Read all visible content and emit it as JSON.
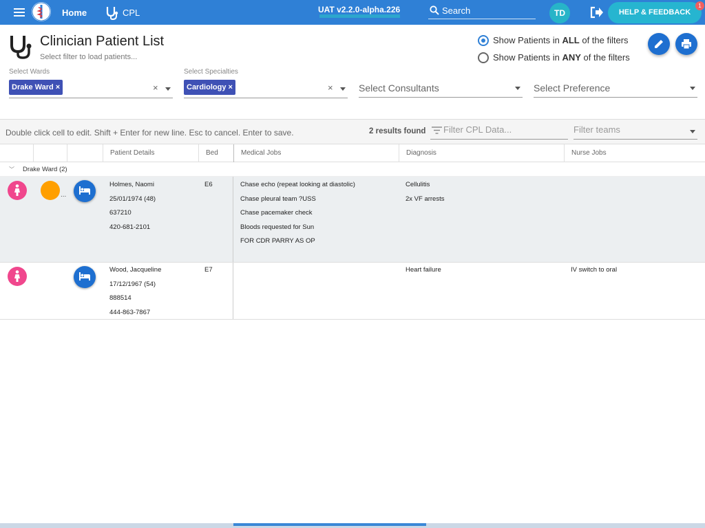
{
  "topbar": {
    "home_label": "Home",
    "app_label": "CPL",
    "version": "UAT v2.2.0-alpha.226",
    "search_label": "Search",
    "user_initials": "TD",
    "help_label": "HELP & FEEDBACK",
    "help_badge": "1"
  },
  "header": {
    "title": "Clinician Patient List",
    "subtitle": "Select filter to load patients...",
    "radio_all_pre": "Show Patients in ",
    "radio_all_bold": "ALL",
    "radio_all_post": " of the filters",
    "radio_any_pre": "Show Patients in ",
    "radio_any_bold": "ANY",
    "radio_any_post": " of the filters",
    "selected_radio": "ALL"
  },
  "filters": {
    "wards_label": "Select Wards",
    "ward_chip": "Drake Ward",
    "specialties_label": "Select Specialties",
    "specialty_chip": "Cardiology",
    "consultants_placeholder": "Select Consultants",
    "preference_placeholder": "Select Preference"
  },
  "toolbar": {
    "hint": "Double click cell to edit. Shift + Enter for new line. Esc to cancel. Enter to save.",
    "results": "2 results found",
    "filter_data_placeholder": "Filter CPL Data...",
    "filter_teams_placeholder": "Filter teams"
  },
  "table": {
    "columns": [
      "Patient Details",
      "Bed",
      "Medical Jobs",
      "Diagnosis",
      "Nurse Jobs"
    ],
    "group_label": "Drake Ward (2)",
    "rows": [
      {
        "name": "Holmes, Naomi",
        "dob": "25/01/1974 (48)",
        "id": "637210",
        "phone": "420-681-2101",
        "bed": "E6",
        "medical_jobs": [
          "Chase echo (repeat looking at diastolic)",
          "Chase pleural team ?USS",
          "Chase pacemaker check",
          "Bloods requested for Sun",
          "FOR CDR PARRY AS OP"
        ],
        "diagnosis": [
          "Cellulitis",
          "2x VF arrests"
        ],
        "nurse_jobs": "",
        "ellipsis": "..."
      },
      {
        "name": "Wood, Jacqueline",
        "dob": "17/12/1967 (54)",
        "id": "888514",
        "phone": "444-863-7867",
        "bed": "E7",
        "medical_jobs": [],
        "diagnosis": [
          "Heart failure"
        ],
        "nurse_jobs": "IV switch to oral"
      }
    ]
  },
  "colors": {
    "topbar": "#2f80d6",
    "accent_teal": "#26b5d0",
    "chip": "#3f51b5",
    "female": "#f0478d",
    "alert_orange": "#ff9f00",
    "selected_row": "#eceff1"
  }
}
